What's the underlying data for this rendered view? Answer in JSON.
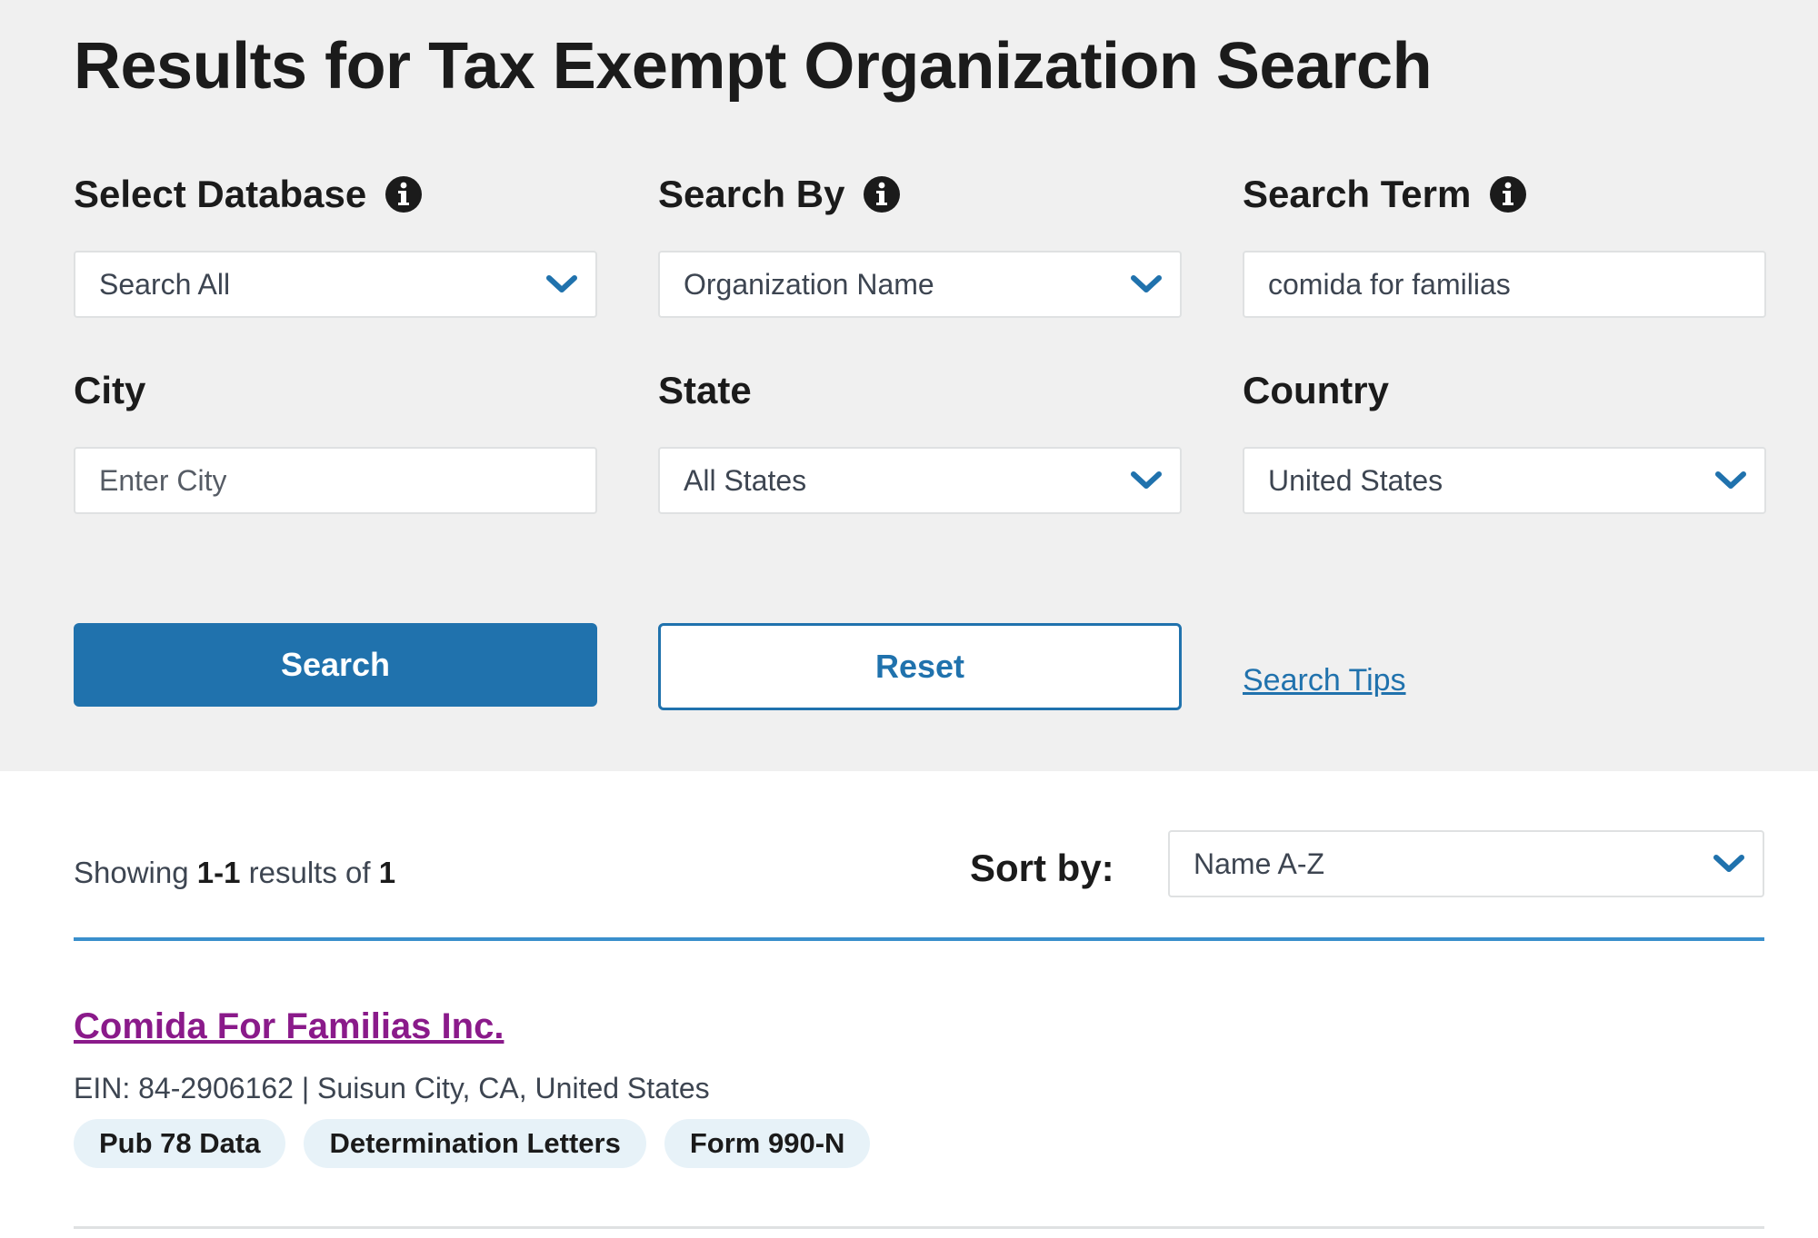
{
  "page_title": "Results for Tax Exempt Organization Search",
  "fields": {
    "database": {
      "label": "Select Database",
      "value": "Search All"
    },
    "search_by": {
      "label": "Search By",
      "value": "Organization Name"
    },
    "search_term": {
      "label": "Search Term",
      "value": "comida for familias"
    },
    "city": {
      "label": "City",
      "placeholder": "Enter City"
    },
    "state": {
      "label": "State",
      "value": "All States"
    },
    "country": {
      "label": "Country",
      "value": "United States"
    }
  },
  "buttons": {
    "search": "Search",
    "reset": "Reset",
    "search_tips": "Search Tips"
  },
  "results": {
    "showing_prefix": "Showing ",
    "range": "1-1",
    "results_of": " results of ",
    "total": "1",
    "sort_label": "Sort by:",
    "sort_value": "Name A-Z",
    "items": [
      {
        "name": "Comida For Familias Inc.",
        "meta": "EIN: 84-2906162 | Suisun City, CA, United States",
        "tags": [
          "Pub 78 Data",
          "Determination Letters",
          "Form 990-N"
        ]
      }
    ]
  },
  "colors": {
    "panel_bg": "#f0f0f0",
    "primary_blue": "#2072ad",
    "visited_link": "#8a1a8a",
    "tag_bg": "#e7f2f8"
  }
}
